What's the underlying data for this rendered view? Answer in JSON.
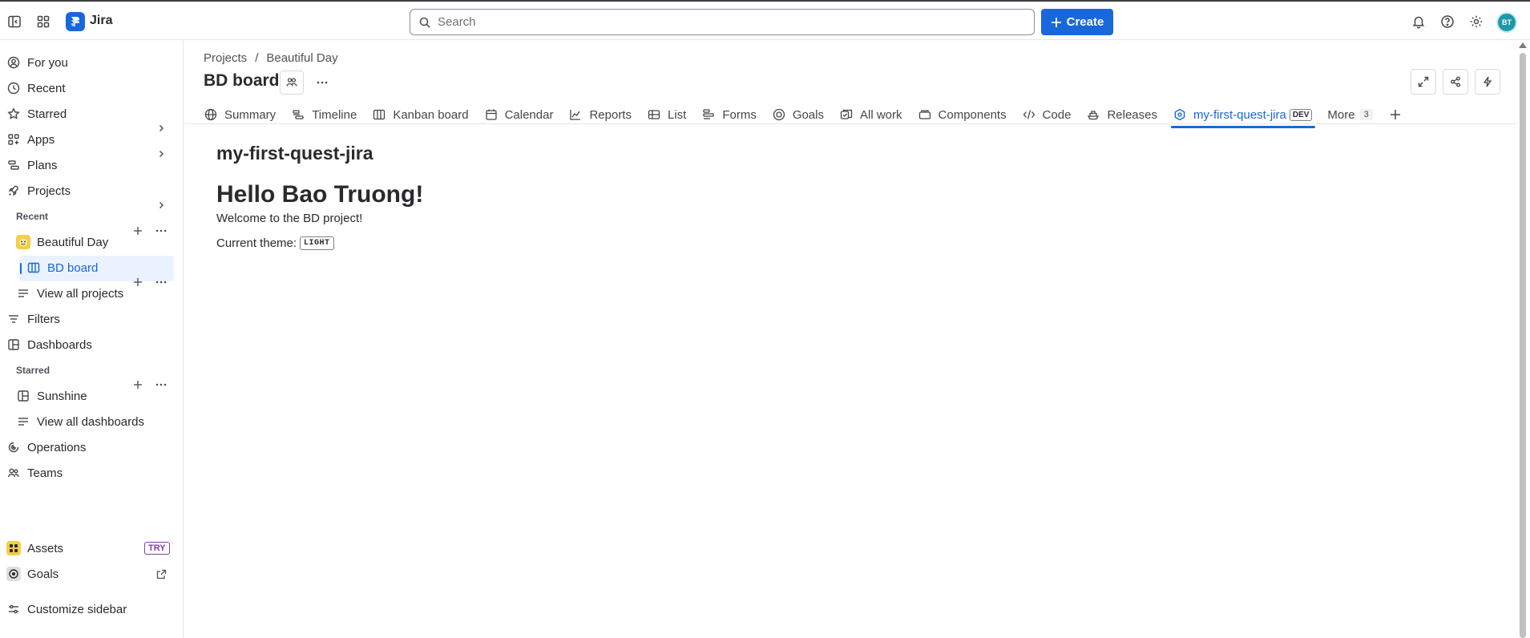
{
  "app": {
    "name": "Jira"
  },
  "search": {
    "placeholder": "Search"
  },
  "create_label": "Create",
  "user": {
    "initials": "BT"
  },
  "sidebar": {
    "for_you": "For you",
    "recent": "Recent",
    "starred": "Starred",
    "apps": "Apps",
    "plans": "Plans",
    "projects": "Projects",
    "recent_heading": "Recent",
    "project_name": "Beautiful Day",
    "board_name": "BD board",
    "view_all_projects": "View all projects",
    "filters": "Filters",
    "dashboards": "Dashboards",
    "starred_heading": "Starred",
    "sunshine": "Sunshine",
    "view_all_dashboards": "View all dashboards",
    "operations": "Operations",
    "teams": "Teams",
    "assets": "Assets",
    "try_badge": "TRY",
    "goals": "Goals",
    "customize": "Customize sidebar"
  },
  "breadcrumb": {
    "projects": "Projects",
    "separator": "/",
    "project": "Beautiful Day"
  },
  "board_title": "BD board",
  "tabs": [
    {
      "label": "Summary",
      "icon": "globe-icon"
    },
    {
      "label": "Timeline",
      "icon": "timeline-icon"
    },
    {
      "label": "Kanban board",
      "icon": "board-icon"
    },
    {
      "label": "Calendar",
      "icon": "calendar-icon"
    },
    {
      "label": "Reports",
      "icon": "chart-icon"
    },
    {
      "label": "List",
      "icon": "list-icon"
    },
    {
      "label": "Forms",
      "icon": "forms-icon"
    },
    {
      "label": "Goals",
      "icon": "target-icon"
    },
    {
      "label": "All work",
      "icon": "stack-icon"
    },
    {
      "label": "Components",
      "icon": "component-icon"
    },
    {
      "label": "Code",
      "icon": "code-icon"
    },
    {
      "label": "Releases",
      "icon": "ship-icon"
    },
    {
      "label": "my-first-quest-jira",
      "icon": "app-icon",
      "badge": "DEV",
      "active": true
    },
    {
      "label": "More",
      "count": "3"
    }
  ],
  "content": {
    "app_title": "my-first-quest-jira",
    "greeting": "Hello Bao Truong!",
    "welcome": "Welcome to the BD project!",
    "theme_label": "Current theme:",
    "theme_value": "LIGHT"
  },
  "colors": {
    "accent": "#1868db",
    "active_bg": "#e9f2fe",
    "try_purple": "#803fa5"
  }
}
